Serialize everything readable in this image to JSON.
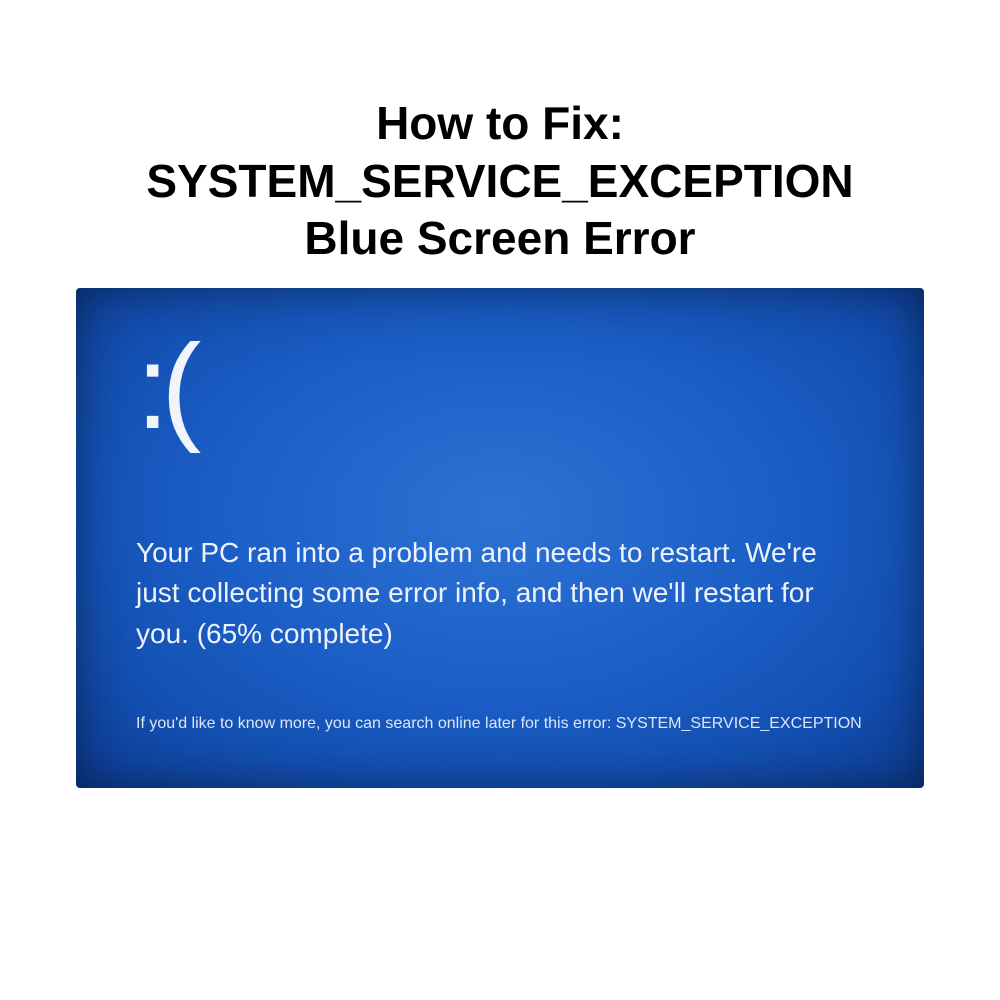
{
  "title": {
    "line1": "How to Fix:",
    "line2": "SYSTEM_SERVICE_EXCEPTION",
    "line3": "Blue Screen Error"
  },
  "bsod": {
    "sad_face": ":(",
    "message": "Your PC ran into a problem and needs to restart. We're just collecting some error info, and then we'll restart for you. (65% complete)",
    "footer": "If you'd like to know more, you can search online later for this error: SYSTEM_SERVICE_EXCEPTION",
    "error_code": "SYSTEM_SERVICE_EXCEPTION",
    "progress_percent": 65
  },
  "colors": {
    "bsod_bg": "#1b5fc7",
    "bsod_text": "#eef3fb",
    "page_bg": "#ffffff",
    "title_text": "#000000"
  }
}
